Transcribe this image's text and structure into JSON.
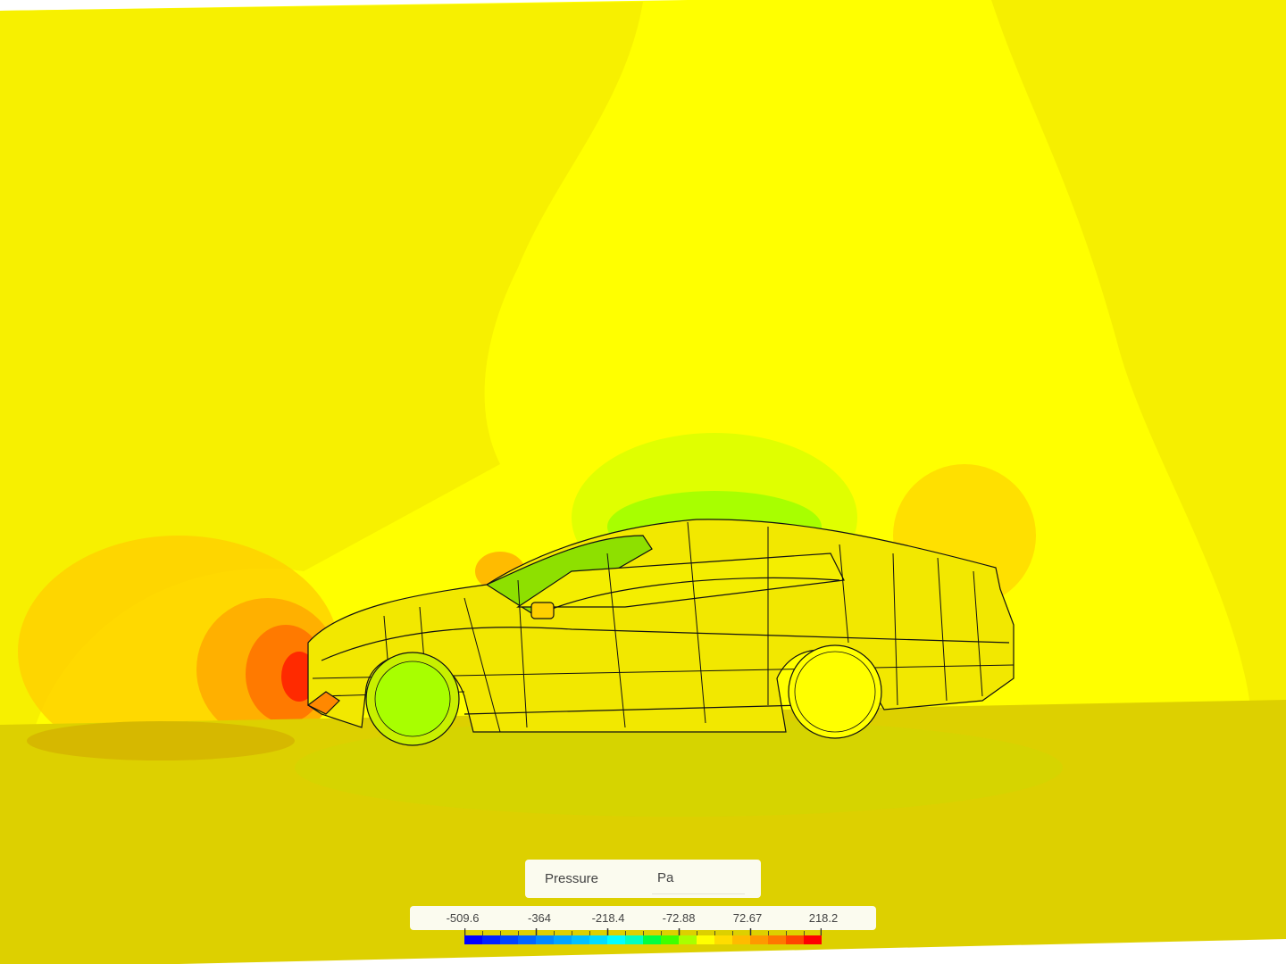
{
  "legend": {
    "title": "Pressure",
    "unit": "Pa",
    "ticks": [
      "-509.6",
      "-364",
      "-218.4",
      "-72.88",
      "72.67",
      "218.2"
    ],
    "colorbar": [
      "#0000ff",
      "#0022ff",
      "#0044ff",
      "#0066ff",
      "#0088ff",
      "#00a4ff",
      "#00c0ff",
      "#00dcff",
      "#00ffff",
      "#00ffc0",
      "#00ff40",
      "#40ff00",
      "#a8ff00",
      "#ffff00",
      "#ffdd00",
      "#ffbb00",
      "#ff9900",
      "#ff7700",
      "#ff4400",
      "#ff0000"
    ]
  }
}
